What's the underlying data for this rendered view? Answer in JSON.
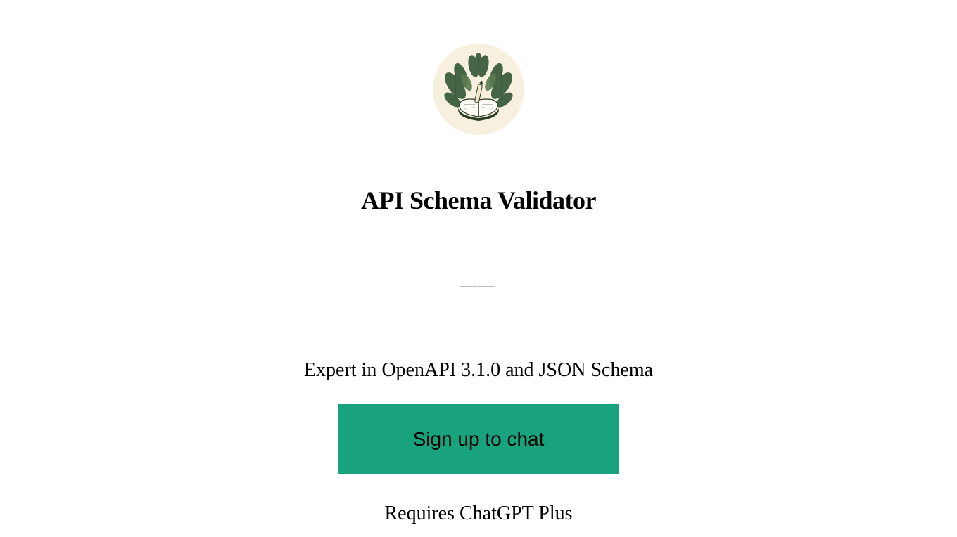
{
  "avatar": {
    "background": "#F8F0DE",
    "icon_description": "book-with-leaves-icon"
  },
  "title": "API Schema Validator",
  "divider_text": "——",
  "description": "Expert in OpenAPI 3.1.0 and JSON Schema",
  "signup_button_label": "Sign up to chat",
  "requires_text": "Requires ChatGPT Plus",
  "colors": {
    "button_bg": "#18A27D",
    "avatar_bg": "#F8F0DE"
  }
}
